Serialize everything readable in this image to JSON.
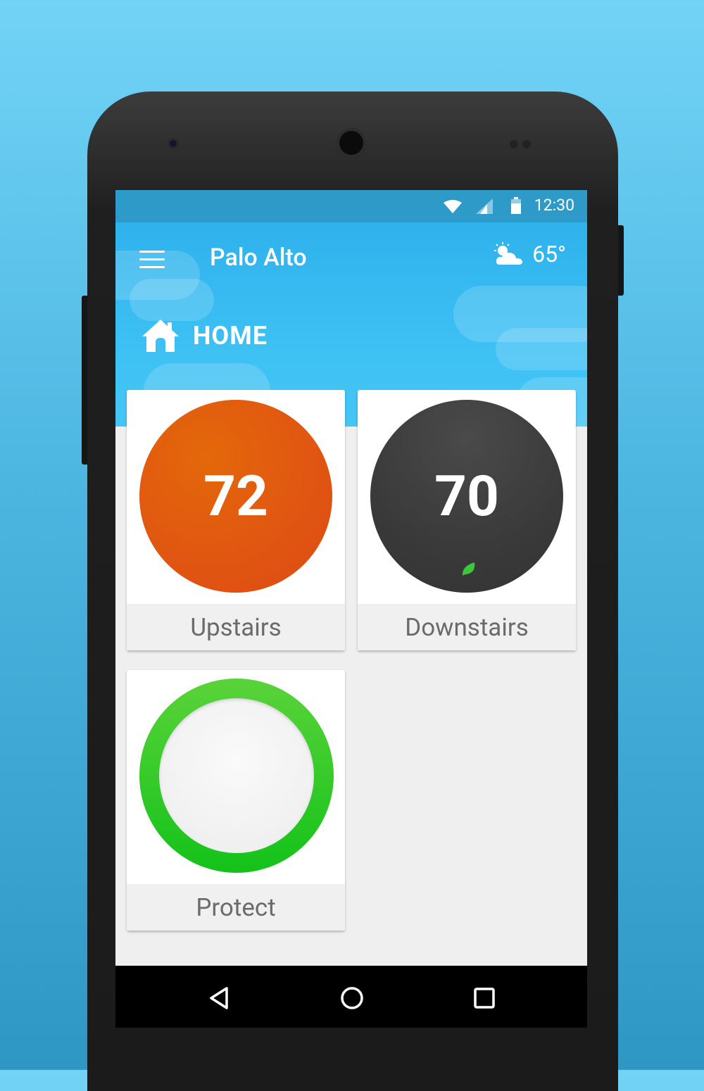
{
  "status": {
    "time": "12:30",
    "wifi_icon": "wifi-icon",
    "signal_icon": "signal-icon",
    "battery_icon": "battery-icon"
  },
  "header": {
    "title": "Palo Alto",
    "weather_icon": "partly-cloudy-icon",
    "temperature": "65°",
    "menu_icon": "menu-icon"
  },
  "section": {
    "icon": "home-icon",
    "label": "HOME"
  },
  "devices": [
    {
      "name": "Upstairs",
      "value": "72",
      "color": "#e05a12"
    },
    {
      "name": "Downstairs",
      "value": "70",
      "color": "#3d3d3d",
      "leaf_icon": "leaf-icon"
    },
    {
      "name": "Protect",
      "ring_color": "#2ed42a"
    }
  ],
  "navbar": {
    "back_icon": "back-icon",
    "home_icon": "home-circle-icon",
    "recents_icon": "recents-icon"
  }
}
